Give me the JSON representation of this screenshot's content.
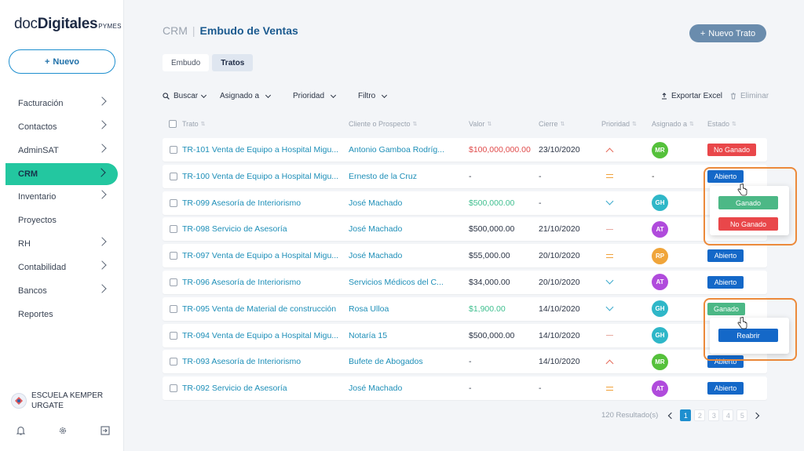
{
  "logo": {
    "part1": "doc",
    "part2": "Digitales",
    "suffix": "PYMES"
  },
  "sidebar": {
    "new_button": "Nuevo",
    "items": [
      {
        "label": "Facturación",
        "has_chevron": true
      },
      {
        "label": "Contactos",
        "has_chevron": true
      },
      {
        "label": "AdminSAT",
        "has_chevron": true
      },
      {
        "label": "CRM",
        "has_chevron": true,
        "active": true
      },
      {
        "label": "Inventario",
        "has_chevron": true
      },
      {
        "label": "Proyectos",
        "has_chevron": false
      },
      {
        "label": "RH",
        "has_chevron": true
      },
      {
        "label": "Contabilidad",
        "has_chevron": true
      },
      {
        "label": "Bancos",
        "has_chevron": true
      },
      {
        "label": "Reportes",
        "has_chevron": false
      }
    ],
    "org_line1": "ESCUELA KEMPER",
    "org_line2": "URGATE",
    "footer_icons": [
      "bell-icon",
      "gear-icon",
      "logout-icon"
    ]
  },
  "header": {
    "crumb_root": "CRM",
    "separator": "|",
    "title": "Embudo de Ventas",
    "new_deal_button": "Nuevo Trato"
  },
  "tabs": [
    {
      "label": "Embudo",
      "active": false
    },
    {
      "label": "Tratos",
      "active": true
    }
  ],
  "toolbar": {
    "search": "Buscar",
    "assigned": "Asignado a",
    "priority": "Prioridad",
    "filter": "Filtro",
    "export": "Exportar Excel",
    "delete": "Eliminar"
  },
  "table": {
    "headers": {
      "trato": "Trato",
      "cliente": "Cliente o Prospecto",
      "valor": "Valor",
      "cierre": "Cierre",
      "prioridad": "Prioridad",
      "asignado": "Asignado a",
      "estado": "Estado"
    },
    "rows": [
      {
        "trato": "TR-101 Venta de Equipo a Hospital Migu...",
        "cliente": "Antonio Gamboa Rodríg...",
        "valor": "$100,000,000.00",
        "valor_color": "red",
        "cierre": "23/10/2020",
        "prioridad": "up",
        "asignado": "MR",
        "avatar_color": "#55c13b",
        "estado": "No Ganado",
        "estado_color": "#e9474a"
      },
      {
        "trato": "TR-100 Venta de Equipo a Hospital Migu...",
        "cliente": "Ernesto de la Cruz",
        "valor": "-",
        "valor_color": "",
        "cierre": "-",
        "prioridad": "eq",
        "asignado": "-",
        "avatar_color": "",
        "estado": "Abierto",
        "estado_color": "#1468c8"
      },
      {
        "trato": "TR-099 Asesoría de Interiorismo",
        "cliente": "José Machado",
        "valor": "$500,000.00",
        "valor_color": "green",
        "cierre": "-",
        "prioridad": "down",
        "asignado": "GH",
        "avatar_color": "#2fb7c8",
        "estado": "",
        "estado_color": ""
      },
      {
        "trato": "TR-098 Servicio de Asesoría",
        "cliente": "José Machado",
        "valor": "$500,000.00",
        "valor_color": "",
        "cierre": "21/10/2020",
        "prioridad": "dash",
        "asignado": "AT",
        "avatar_color": "#b04bdc",
        "estado": "",
        "estado_color": ""
      },
      {
        "trato": "TR-097 Venta de Equipo a Hospital Migu...",
        "cliente": "José Machado",
        "valor": "$55,000.00",
        "valor_color": "",
        "cierre": "20/10/2020",
        "prioridad": "eq",
        "asignado": "RP",
        "avatar_color": "#f0a53a",
        "estado": "Abierto",
        "estado_color": "#1468c8"
      },
      {
        "trato": "TR-096 Asesoría de Interiorismo",
        "cliente": "Servicios Médicos del C...",
        "valor": "$34,000.00",
        "valor_color": "",
        "cierre": "20/10/2020",
        "prioridad": "down",
        "asignado": "AT",
        "avatar_color": "#b04bdc",
        "estado": "Abierto",
        "estado_color": "#1468c8"
      },
      {
        "trato": "TR-095 Venta de Material de construcción",
        "cliente": "Rosa Ulloa",
        "valor": "$1,900.00",
        "valor_color": "green",
        "cierre": "14/10/2020",
        "prioridad": "down",
        "asignado": "GH",
        "avatar_color": "#2fb7c8",
        "estado": "Ganado",
        "estado_color": "#4cb886"
      },
      {
        "trato": "TR-094 Venta de Equipo a Hospital Migu...",
        "cliente": "Notaría 15",
        "valor": "$500,000.00",
        "valor_color": "",
        "cierre": "14/10/2020",
        "prioridad": "dash",
        "asignado": "GH",
        "avatar_color": "#2fb7c8",
        "estado": "",
        "estado_color": ""
      },
      {
        "trato": "TR-093 Asesoría de Interiorismo",
        "cliente": "Bufete de Abogados",
        "valor": "-",
        "valor_color": "",
        "cierre": "14/10/2020",
        "prioridad": "up",
        "asignado": "MR",
        "avatar_color": "#55c13b",
        "estado": "Abierto",
        "estado_color": "#1468c8"
      },
      {
        "trato": "TR-092 Servicio de Asesoría",
        "cliente": "José Machado",
        "valor": "-",
        "valor_color": "",
        "cierre": "-",
        "prioridad": "eq",
        "asignado": "AT",
        "avatar_color": "#b04bdc",
        "estado": "Abierto",
        "estado_color": "#1468c8"
      }
    ]
  },
  "popup_status": {
    "won": "Ganado",
    "lost": "No Ganado",
    "won_color": "#4cb886",
    "lost_color": "#e9474a"
  },
  "popup_reopen": {
    "reopen": "Reabrir",
    "color": "#1468c8"
  },
  "highlight_color": "#ec8a3b",
  "pagination": {
    "results": "120 Resultado(s)",
    "pages": [
      "1",
      "2",
      "3",
      "4",
      "5"
    ],
    "current": "1"
  }
}
